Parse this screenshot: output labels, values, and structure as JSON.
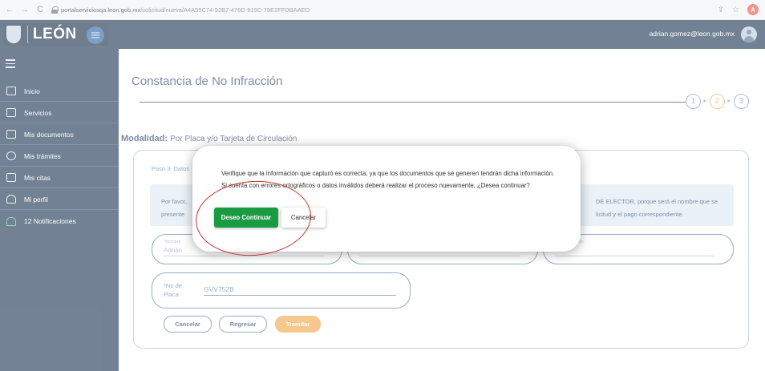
{
  "browser": {
    "back_glyph": "←",
    "forward_glyph": "→",
    "reload_glyph": "C",
    "url_host": "portalserviciosqa.leon.gob.mx",
    "url_path": "/solicitud/nueva/A4A55C74-92B7-476D-919C-79E2FFDBAAED",
    "share_glyph": "⇪",
    "star_glyph": "☆",
    "profile_initial": "A"
  },
  "header": {
    "logo_text": "LEÓN",
    "user_email": "adrian.gomez@leon.gob.mx"
  },
  "sidebar": {
    "items": [
      {
        "label": "Inicio",
        "icon": "house-icon"
      },
      {
        "label": "Servicios",
        "icon": "play-icon"
      },
      {
        "label": "Mis documentos",
        "icon": "document-icon"
      },
      {
        "label": "Mis trámites",
        "icon": "gear-icon"
      },
      {
        "label": "Mis citas",
        "icon": "calendar-icon"
      },
      {
        "label": "Mi perfil",
        "icon": "person-icon"
      },
      {
        "label": "12 Notificaciones",
        "icon": "bell-icon"
      }
    ]
  },
  "main": {
    "title": "Constancia de No Infracción",
    "steps": [
      "1",
      "2",
      "3"
    ],
    "active_step": 2,
    "modalidad_label": "Modalidad:",
    "modalidad_value": "Por Placa y/o Tarjeta de Circulación",
    "step_label": "Paso 3. Datos",
    "info_left_1": "Por favor,",
    "info_left_2": "presente",
    "info_right_1": "DE ELECTOR, porque será el nombre que se",
    "info_right_2": "licitud y el pago correspondiente.",
    "field_nombre_label": "*Nombre",
    "field_nombre_value": "Adrián",
    "field_apellido_label": "Apellido",
    "placa_label": "*No de Placa",
    "placa_value": "GVV752B",
    "btn_cancelar": "Cancelar",
    "btn_regresar": "Regresar",
    "btn_tramitar": "Tramitar"
  },
  "modal": {
    "message": "Verifique que la información que capturó es correcta, ya que los documentos que se generen tendrán dicha información. Si cuenta con errores ortográficos o datos inválidos deberá realizar el proceso nuevamente. ¿Desea continuar?",
    "confirm_label": "Deseo Continuar",
    "cancel_label": "Cancelar"
  },
  "colors": {
    "navy": "#0d2746",
    "accent_orange": "#f0a03c",
    "confirm_green": "#1a9b42",
    "annotation_red": "#d1302c"
  }
}
